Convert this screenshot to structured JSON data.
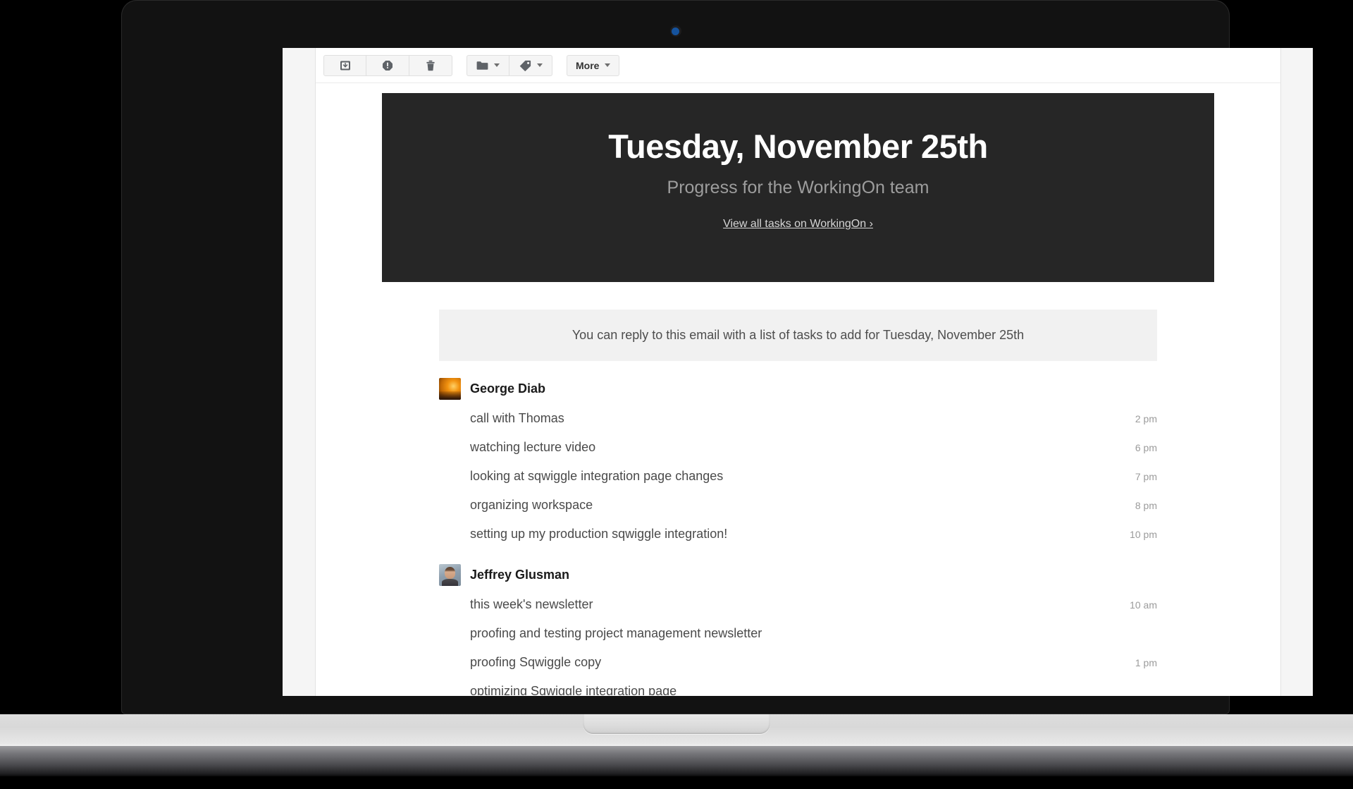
{
  "window": {
    "device": "laptop-mockup",
    "camera_indicator_color": "#15539e"
  },
  "toolbar": {
    "buttons": [
      {
        "name": "archive-button",
        "icon": "archive-icon",
        "label": "",
        "has_caret": false
      },
      {
        "name": "report-spam-button",
        "icon": "exclamation-octagon-icon",
        "label": "",
        "has_caret": false
      },
      {
        "name": "delete-button",
        "icon": "trash-icon",
        "label": "",
        "has_caret": false
      },
      {
        "name": "move-to-folder-button",
        "icon": "folder-icon",
        "label": "",
        "has_caret": true
      },
      {
        "name": "labels-button",
        "icon": "tag-icon",
        "label": "",
        "has_caret": true
      },
      {
        "name": "more-button",
        "icon": "",
        "label": "More",
        "has_caret": true
      }
    ],
    "more_label": "More"
  },
  "email": {
    "hero": {
      "title": "Tuesday, November 25th",
      "subtitle": "Progress for the WorkingOn team",
      "link": "View all tasks on WorkingOn ›",
      "background_color": "#262626"
    },
    "reply_note": "You can reply to this email with a list of tasks to add for Tuesday, November 25th",
    "people": [
      {
        "name": "George Diab",
        "avatar": "avatar-george",
        "tasks": [
          {
            "text": "call with Thomas",
            "time": "2 pm"
          },
          {
            "text": "watching lecture video",
            "time": "6 pm"
          },
          {
            "text": "looking at sqwiggle integration page changes",
            "time": "7 pm"
          },
          {
            "text": "organizing workspace",
            "time": "8 pm"
          },
          {
            "text": "setting up my production sqwiggle integration!",
            "time": "10 pm"
          }
        ]
      },
      {
        "name": "Jeffrey Glusman",
        "avatar": "avatar-jeffrey",
        "tasks": [
          {
            "text": "this week's newsletter",
            "time": "10 am"
          },
          {
            "text": "proofing and testing project management newsletter",
            "time": ""
          },
          {
            "text": "proofing Sqwiggle copy",
            "time": "1 pm"
          },
          {
            "text": "optimizing Sqwiggle integration page",
            "time": ""
          }
        ]
      }
    ]
  }
}
